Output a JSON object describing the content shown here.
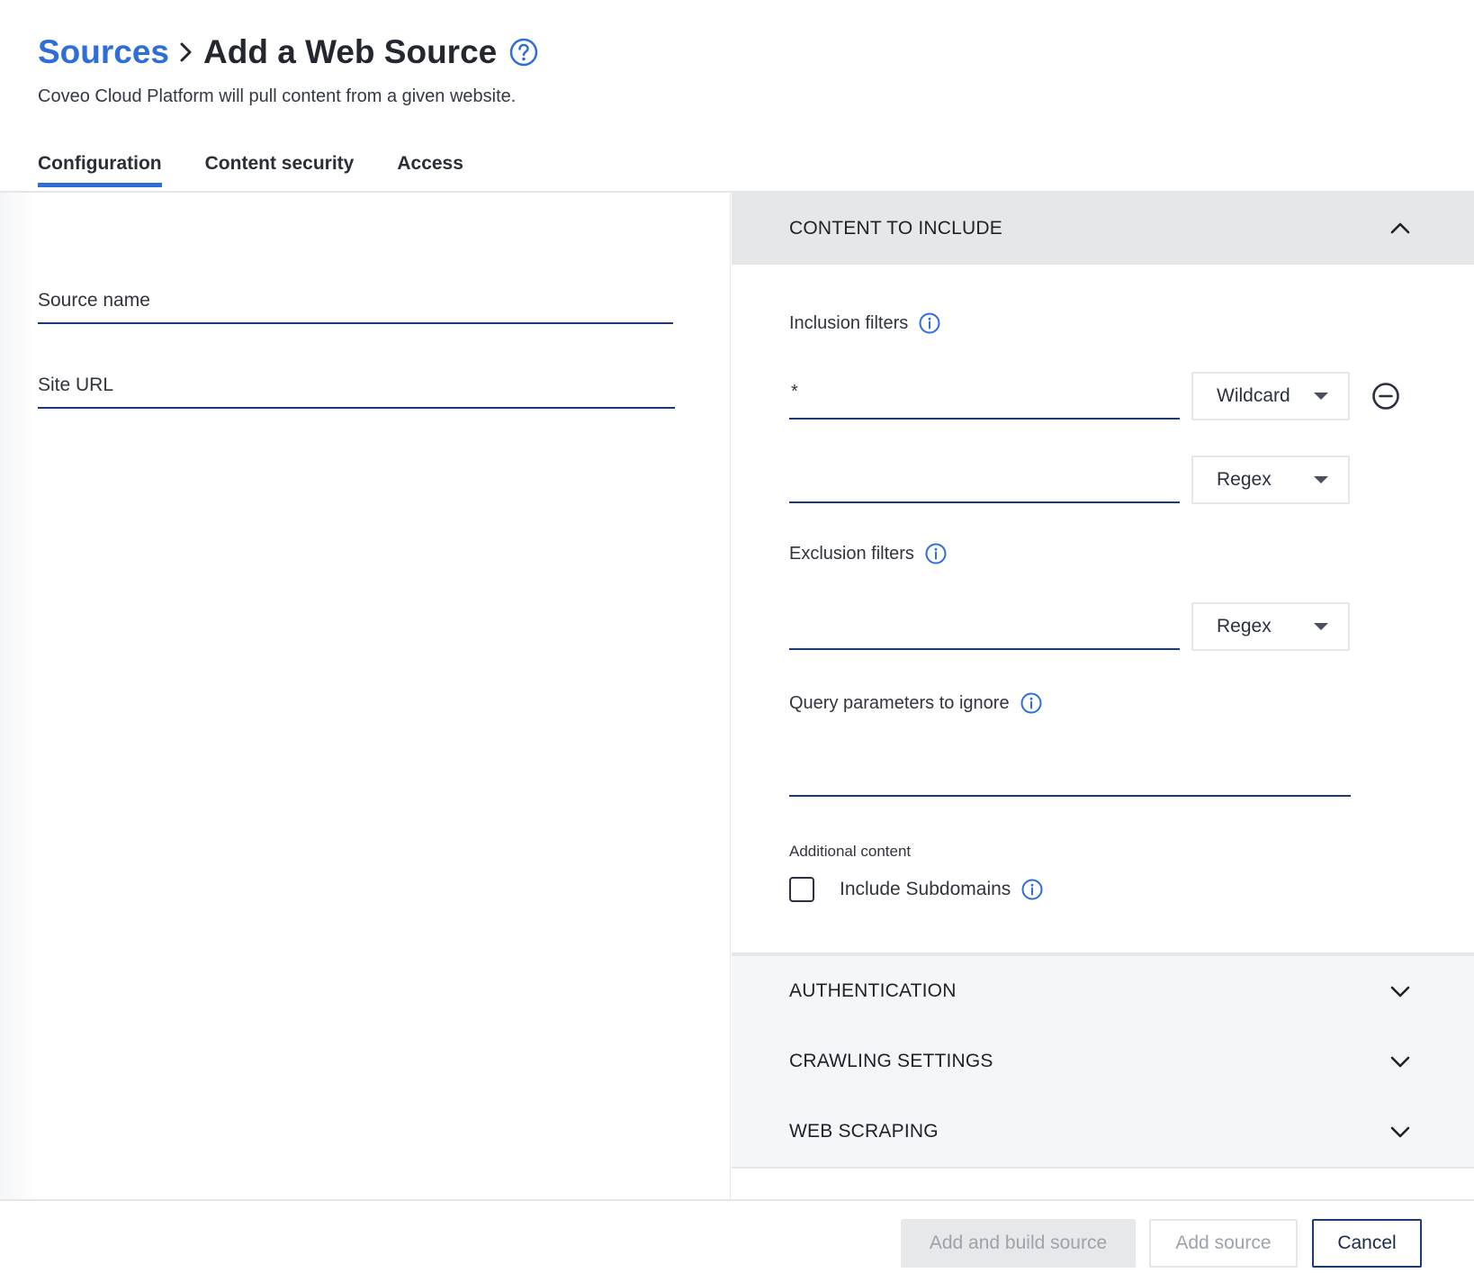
{
  "header": {
    "breadcrumb_link": "Sources",
    "title": "Add a Web Source",
    "subtitle": "Coveo Cloud Platform will pull content from a given website."
  },
  "tabs": [
    {
      "label": "Configuration",
      "active": true
    },
    {
      "label": "Content security",
      "active": false
    },
    {
      "label": "Access",
      "active": false
    }
  ],
  "left": {
    "source_name_label": "Source name",
    "site_url_label": "Site URL"
  },
  "content_to_include": {
    "title": "CONTENT TO INCLUDE",
    "inclusion_label": "Inclusion filters",
    "inclusion_filters": [
      {
        "value": "*",
        "type": "Wildcard"
      },
      {
        "value": "",
        "type": "Regex"
      }
    ],
    "exclusion_label": "Exclusion filters",
    "exclusion_filters": [
      {
        "value": "",
        "type": "Regex"
      }
    ],
    "query_params_label": "Query parameters to ignore",
    "additional_content_label": "Additional content",
    "include_subdomains_label": "Include Subdomains",
    "include_subdomains_checked": false
  },
  "sections": {
    "authentication": "AUTHENTICATION",
    "crawling": "CRAWLING SETTINGS",
    "scraping": "WEB SCRAPING"
  },
  "footer": {
    "add_build": "Add and build source",
    "add": "Add source",
    "cancel": "Cancel"
  },
  "colors": {
    "accent": "#2f6ed8",
    "underline": "#1d3a75"
  }
}
